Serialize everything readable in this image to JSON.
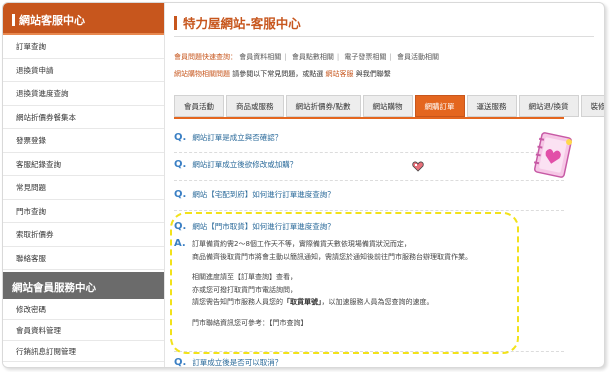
{
  "sidebar": {
    "title": "網站客服中心",
    "items": [
      {
        "label": "訂單查詢"
      },
      {
        "label": "退換貨申請"
      },
      {
        "label": "退換貨進度查詢"
      },
      {
        "label": "網站折價券餐集本"
      },
      {
        "label": "發票登錄"
      },
      {
        "label": "客服紀錄查詢"
      },
      {
        "label": "常見問題"
      },
      {
        "label": "門市查詢"
      },
      {
        "label": "索取折價券"
      },
      {
        "label": "聯絡客服"
      }
    ],
    "member_title": "網站會員服務中心",
    "member_items": [
      {
        "label": "修改密碼"
      },
      {
        "label": "會員資料管理"
      },
      {
        "label": "行銷訊息訂閱管理"
      }
    ]
  },
  "main": {
    "title": "特力屋網站-客服中心",
    "quick_label": "會員問題快速查詢：",
    "quick_links": [
      {
        "label": "會員資料相關"
      },
      {
        "label": "會員點數相關"
      },
      {
        "label": "電子發票相關"
      },
      {
        "label": "會員活動相關"
      }
    ],
    "shop_label": "網站購物相關問題",
    "shop_text": "請參閱以下常見問題，或點選",
    "shop_link": "網站客服",
    "shop_text2": "與我們聯繫",
    "tabs": [
      {
        "label": "會員活動",
        "active": false
      },
      {
        "label": "商品或服務",
        "active": false
      },
      {
        "label": "網站折價券/點數",
        "active": false
      },
      {
        "label": "網站購物",
        "active": false
      },
      {
        "label": "網購訂單",
        "active": true
      },
      {
        "label": "運送服務",
        "active": false
      },
      {
        "label": "網站退/換貨",
        "active": false
      },
      {
        "label": "裝修中心",
        "active": false
      }
    ],
    "questions": [
      {
        "q": "Q.",
        "text": "網站訂單是成立與否確認？"
      },
      {
        "q": "Q.",
        "text": "網站訂單成立後欲修改或加購？"
      },
      {
        "q": "Q.",
        "text": "網站【宅配到府】如何進行訂單進度查詢？"
      },
      {
        "q": "Q.",
        "text": "網站【門市取貨】如何進行訂單進度查詢？"
      },
      {
        "q": "Q.",
        "text": "訂單成立後是否可以取消？"
      }
    ],
    "answer": {
      "a": "A.",
      "lines": [
        "訂單備貨約需2～8個工作天不等，實際備貨天數依現場備貨狀況而定，",
        "商品備齊後取貨門市將會主動以簡訊通知，需請您於通知後前往門市服務台辦理取貨作業。",
        "相關進度請至【訂單查詢】查看，",
        "亦或您可撥打取貨門市電話詢問，",
        "請您需告知門市服務人員您的「取貨單號」，以加速服務人員為您查詢的速度。",
        "門市聯絡資訊您可參考：【門市查詢】"
      ],
      "bold_part": "取貨單號"
    }
  }
}
